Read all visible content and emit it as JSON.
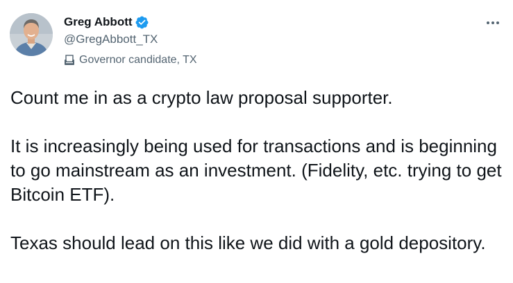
{
  "author": {
    "display_name": "Greg Abbott",
    "handle": "@GregAbbott_TX",
    "label": "Governor candidate, TX",
    "avatar_icon": "profile-photo",
    "verified_icon": "verified-badge-icon",
    "label_icon": "ballot-box-icon"
  },
  "menu": {
    "more_icon": "more-options-icon"
  },
  "tweet": {
    "paragraphs": [
      "Count me in as a crypto law proposal supporter.",
      "It is increasingly being used for transactions and is beginning to go mainstream as an investment. (Fidelity, etc. trying to get Bitcoin ETF).",
      "Texas should lead on this like we did with a gold depository."
    ]
  },
  "colors": {
    "text_primary": "#0f1419",
    "text_secondary": "#536471",
    "verified_blue": "#1d9bf0"
  }
}
